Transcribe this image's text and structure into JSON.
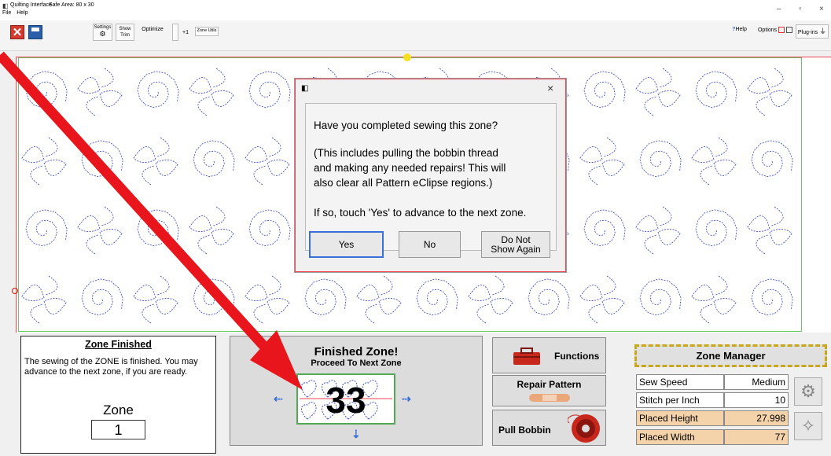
{
  "window": {
    "title": "Quilting Interface",
    "safe_area": "Safe Area: 80 x 30",
    "menu": [
      "File",
      "Help"
    ],
    "controls": [
      "–",
      "▫",
      "×"
    ]
  },
  "toolbar": {
    "settings": "Settings",
    "show_trim": "Show Trim",
    "optimize": "Optimize",
    "plus_one": "+1",
    "zone_utils": "Zone Utils",
    "help": "Help",
    "options": "Options",
    "plugins": "Plug-ins"
  },
  "dialog": {
    "question": "Have you completed sewing this zone?",
    "note_lines": [
      "(This includes pulling the bobbin thread",
      "and making any needed repairs! This will",
      "also clear all Pattern eClipse regions.)"
    ],
    "instruction": "If so, touch 'Yes' to advance to the next zone.",
    "yes": "Yes",
    "no": "No",
    "do_not_line1": "Do Not",
    "do_not_line2": "Show Again",
    "close": "×"
  },
  "zone_finished": {
    "title": "Zone Finished",
    "text": "The sewing of the ZONE is finished. You may advance to the next zone, if you are ready.",
    "zone_label": "Zone",
    "zone_number": "1"
  },
  "finished_zone_button": {
    "title": "Finished Zone!",
    "subtitle": "Proceed To Next Zone",
    "step_number": "33"
  },
  "actions": {
    "functions": "Functions",
    "repair_pattern": "Repair Pattern",
    "pull_bobbin": "Pull Bobbin"
  },
  "zone_manager": {
    "title": "Zone Manager",
    "rows": [
      {
        "label": "Sew Speed",
        "value": "Medium"
      },
      {
        "label": "Stitch per Inch",
        "value": "10"
      },
      {
        "label": "Placed Height",
        "value": "27.998"
      },
      {
        "label": "Placed Width",
        "value": "77"
      }
    ]
  },
  "colors": {
    "accent_blue": "#3b6fd8",
    "annotation_red": "#e8161c",
    "pattern_stitch": "#4455cc",
    "placed_fill": "#f5d3aa"
  }
}
